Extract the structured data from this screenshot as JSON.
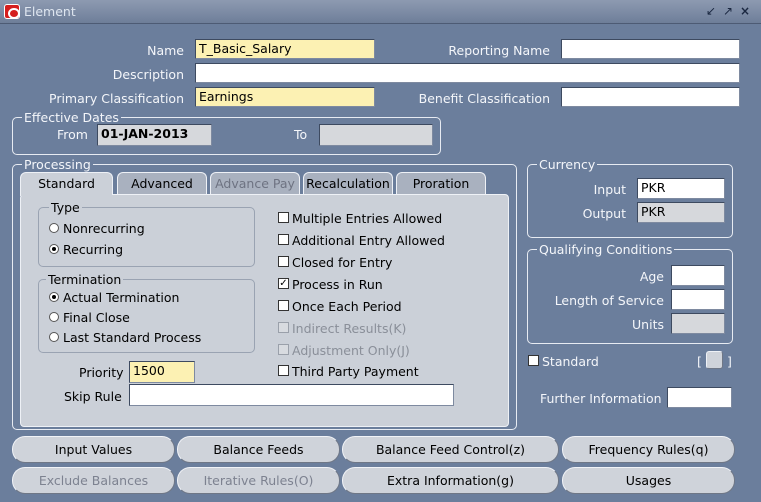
{
  "window": {
    "title": "Element",
    "controls": [
      "restore-down-icon",
      "maximize-icon",
      "close-icon"
    ]
  },
  "form": {
    "name_label": "Name",
    "name_value": "T_Basic_Salary",
    "reporting_name_label": "Reporting Name",
    "reporting_name_value": "",
    "description_label": "Description",
    "description_value": "",
    "primary_classification_label": "Primary Classification",
    "primary_classification_value": "Earnings",
    "benefit_classification_label": "Benefit Classification",
    "benefit_classification_value": ""
  },
  "effective_dates": {
    "title": "Effective Dates",
    "from_label": "From",
    "from_value": "01-JAN-2013",
    "to_label": "To",
    "to_value": ""
  },
  "processing": {
    "title": "Processing",
    "tabs": [
      {
        "label": "Standard",
        "state": "active"
      },
      {
        "label": "Advanced",
        "state": "normal"
      },
      {
        "label": "Advance Pay",
        "state": "disabled"
      },
      {
        "label": "Recalculation",
        "state": "normal"
      },
      {
        "label": "Proration",
        "state": "normal"
      }
    ],
    "type_group": {
      "title": "Type",
      "options": [
        {
          "label": "Nonrecurring",
          "selected": false
        },
        {
          "label": "Recurring",
          "selected": true
        }
      ]
    },
    "termination_group": {
      "title": "Termination",
      "options": [
        {
          "label": "Actual Termination",
          "selected": true
        },
        {
          "label": "Final Close",
          "selected": false
        },
        {
          "label": "Last Standard Process",
          "selected": false
        }
      ]
    },
    "checkboxes": [
      {
        "label": "Multiple Entries Allowed",
        "checked": false,
        "enabled": true
      },
      {
        "label": "Additional Entry Allowed",
        "checked": false,
        "enabled": true
      },
      {
        "label": "Closed for Entry",
        "checked": false,
        "enabled": true
      },
      {
        "label": "Process in Run",
        "checked": true,
        "enabled": true
      },
      {
        "label": "Once Each Period",
        "checked": false,
        "enabled": true
      },
      {
        "label": "Indirect Results(K)",
        "checked": false,
        "enabled": false
      },
      {
        "label": "Adjustment Only(J)",
        "checked": false,
        "enabled": false
      },
      {
        "label": "Third Party Payment",
        "checked": false,
        "enabled": true
      }
    ],
    "priority_label": "Priority",
    "priority_value": "1500",
    "skip_rule_label": "Skip Rule",
    "skip_rule_value": ""
  },
  "currency": {
    "title": "Currency",
    "input_label": "Input",
    "input_value": "PKR",
    "output_label": "Output",
    "output_value": "PKR"
  },
  "qualifying_conditions": {
    "title": "Qualifying Conditions",
    "age_label": "Age",
    "age_value": "",
    "length_of_service_label": "Length of Service",
    "length_of_service_value": "",
    "units_label": "Units",
    "units_value": ""
  },
  "standard_checkbox": {
    "label": "Standard",
    "checked": false,
    "bracket_open": "[",
    "bracket_close": "]"
  },
  "further_information": {
    "label": "Further Information",
    "value": ""
  },
  "buttons": {
    "row1": [
      {
        "label": "Input Values",
        "enabled": true
      },
      {
        "label": "Balance Feeds",
        "enabled": true
      },
      {
        "label": "Balance Feed Control(z)",
        "enabled": true
      },
      {
        "label": "Frequency Rules(q)",
        "enabled": true
      }
    ],
    "row2": [
      {
        "label": "Exclude Balances",
        "enabled": false
      },
      {
        "label": "Iterative Rules(O)",
        "enabled": false
      },
      {
        "label": "Extra Information(g)",
        "enabled": true
      },
      {
        "label": "Usages",
        "enabled": true
      }
    ]
  }
}
